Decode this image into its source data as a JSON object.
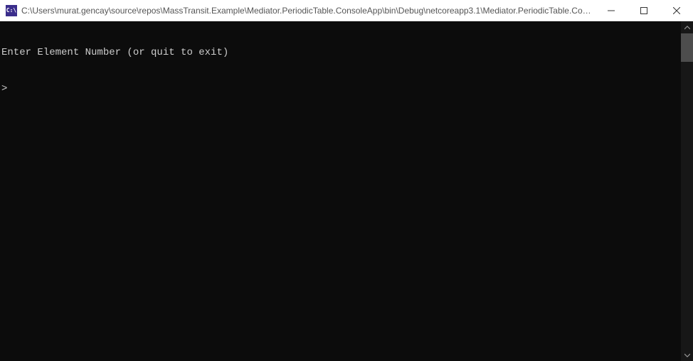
{
  "window": {
    "icon_text": "C:\\",
    "title": "C:\\Users\\murat.gencay\\source\\repos\\MassTransit.Example\\Mediator.PeriodicTable.ConsoleApp\\bin\\Debug\\netcoreapp3.1\\Mediator.PeriodicTable.Con..."
  },
  "console": {
    "line1": "Enter Element Number (or quit to exit)",
    "line2": ">"
  }
}
